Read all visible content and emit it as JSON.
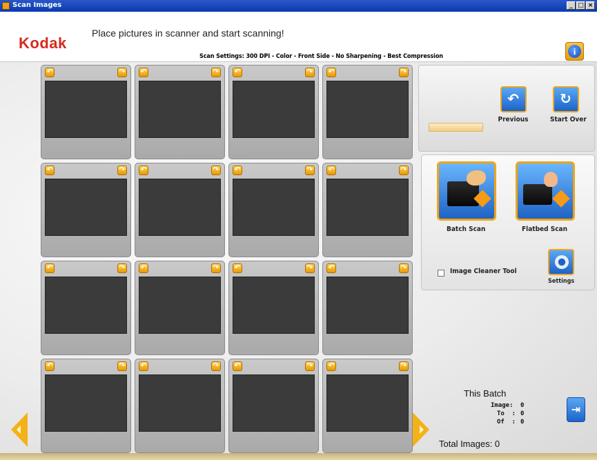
{
  "window": {
    "title": "Scan Images",
    "min_glyph": "_",
    "max_glyph": "□",
    "close_glyph": "×"
  },
  "header": {
    "logo": "Kodak",
    "instruction": "Place pictures in scanner and start scanning!",
    "scan_settings": "Scan Settings: 300 DPI - Color - Front Side - No Sharpening - Best Compression",
    "info_glyph": "i"
  },
  "grid": {
    "rows": 4,
    "columns": 4,
    "rotate_left_glyph": "↶",
    "rotate_right_glyph": "↷"
  },
  "nav": {
    "previous_label": "Previous",
    "previous_glyph": "↶",
    "start_over_label": "Start Over",
    "start_over_glyph": "↻"
  },
  "scan_options": {
    "batch_scan_label": "Batch Scan",
    "flatbed_scan_label": "Flatbed Scan",
    "image_cleaner_label": "Image Cleaner Tool",
    "image_cleaner_checked": false,
    "settings_label": "Settings"
  },
  "batch": {
    "title": "This Batch",
    "image_label": "Image:",
    "image_value": "0",
    "to_label": "To  :",
    "to_value": "0",
    "of_label": "Of  :",
    "of_value": "0",
    "total_label": "Total Images: 0"
  },
  "exit_glyph": "⇥",
  "colors": {
    "accent_orange": "#f0a517",
    "brand_red": "#d52b1e",
    "button_blue": "#1c63c9"
  },
  "icons": [
    "rotate-left-icon",
    "rotate-right-icon",
    "info-icon",
    "previous-icon",
    "start-over-icon",
    "batch-scan-icon",
    "flatbed-scan-icon",
    "settings-icon",
    "exit-icon",
    "page-left-icon",
    "page-right-icon"
  ]
}
